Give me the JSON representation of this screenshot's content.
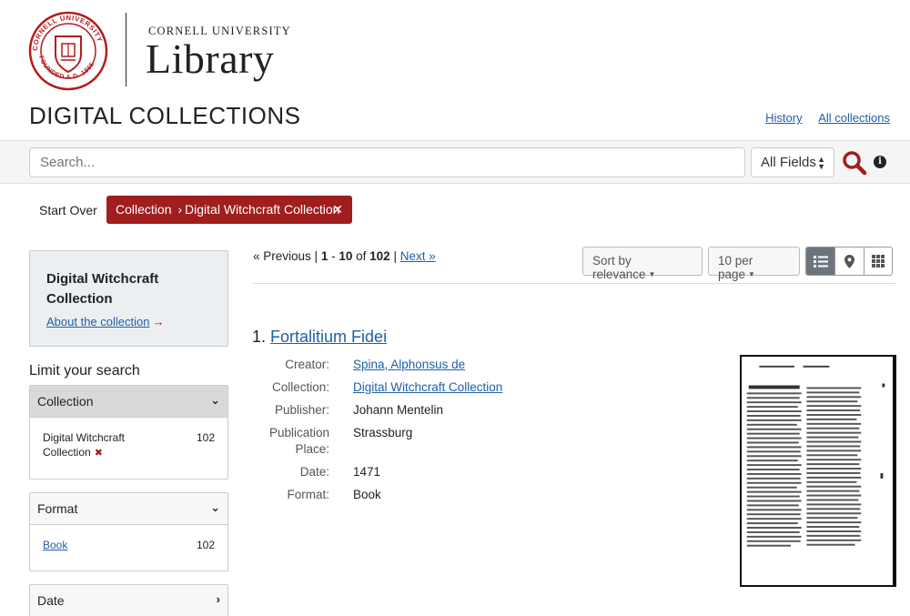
{
  "header": {
    "logo_small": "CORNELL UNIVERSITY",
    "logo_big": "Library",
    "seal_text": "CORNELL UNIVERSITY FOUNDED A.D. 1865",
    "site_title": "DIGITAL COLLECTIONS",
    "links": [
      "History",
      "All collections"
    ]
  },
  "search": {
    "placeholder": "Search...",
    "field": "All Fields"
  },
  "constraints": {
    "start_over": "Start Over",
    "filter_name": "Collection",
    "filter_value": "Digital Witchcraft Collection",
    "remove": "✕"
  },
  "sidebar": {
    "about_title": "Digital Witchcraft Collection",
    "about_link": "About the collection",
    "limit_heading": "Limit your search",
    "facets": [
      {
        "label": "Collection",
        "value": "Digital Witchcraft Collection",
        "count": "102",
        "remove": "✖"
      },
      {
        "label": "Format",
        "value": "Book",
        "count": "102"
      },
      {
        "label": "Date"
      }
    ]
  },
  "results": {
    "prev": "« Previous",
    "range_start": "1",
    "range_end": "10",
    "of": "of",
    "total": "102",
    "next": "Next »",
    "sort": "Sort by relevance",
    "per_page": "10 per page",
    "items": [
      {
        "number": "1.",
        "title": "Fortalitium Fidei",
        "fields": [
          {
            "label": "Creator:",
            "value": "Spina, Alphonsus de",
            "link": true
          },
          {
            "label": "Collection:",
            "value": "Digital Witchcraft Collection",
            "link": true
          },
          {
            "label": "Publisher:",
            "value": "Johann Mentelin",
            "link": false
          },
          {
            "label": "Publication Place:",
            "value": "Strassburg",
            "link": false
          },
          {
            "label": "Date:",
            "value": "1471",
            "link": false
          },
          {
            "label": "Format:",
            "value": "Book",
            "link": false
          }
        ]
      }
    ]
  },
  "colors": {
    "brand_red": "#a01e1e",
    "link_blue": "#1f5fa8"
  }
}
